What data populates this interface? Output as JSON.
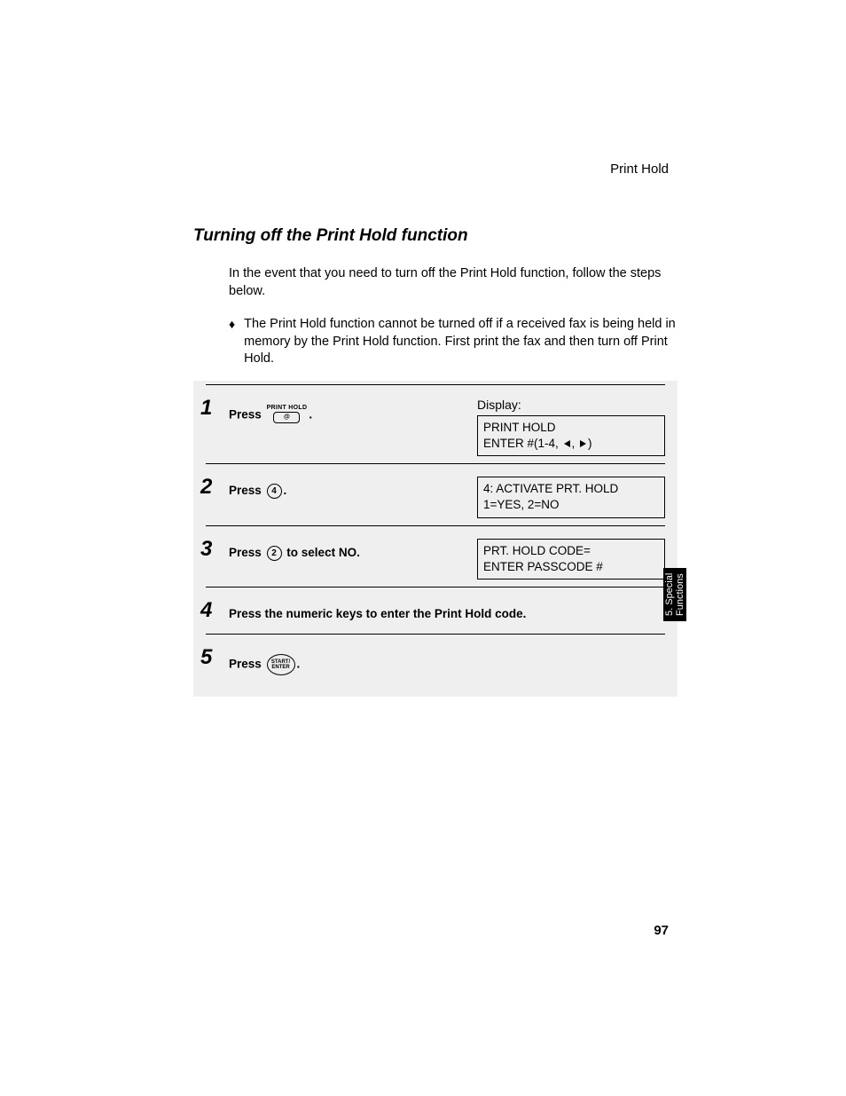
{
  "running_head": "Print Hold",
  "section_title": "Turning off the Print Hold function",
  "intro": "In the event that you need to turn off the Print Hold function, follow the steps below.",
  "bullet": "The Print Hold function cannot be turned off if a received fax is being held in memory by the Print Hold function. First print the fax and then turn off Print Hold.",
  "display_label": "Display:",
  "steps": {
    "s1": {
      "num": "1",
      "press": "Press",
      "btn_label": "PRINT HOLD",
      "after": ".",
      "disp_l1": "PRINT HOLD",
      "disp_l2a": "ENTER #(1-4, ",
      "disp_l2b": ", ",
      "disp_l2c": ")"
    },
    "s2": {
      "num": "2",
      "press": "Press ",
      "key": "4",
      "after": ".",
      "disp_l1": "4: ACTIVATE PRT. HOLD",
      "disp_l2": "1=YES, 2=NO"
    },
    "s3": {
      "num": "3",
      "press": "Press ",
      "key": "2",
      "after": " to select NO.",
      "disp_l1": "PRT. HOLD CODE=",
      "disp_l2": "ENTER PASSCODE #"
    },
    "s4": {
      "num": "4",
      "text": "Press the numeric keys to enter the Print Hold code."
    },
    "s5": {
      "num": "5",
      "press": "Press ",
      "key_l1": "START/",
      "key_l2": "ENTER",
      "after": "."
    }
  },
  "side_tab": "5. Special Functions",
  "page_num": "97"
}
